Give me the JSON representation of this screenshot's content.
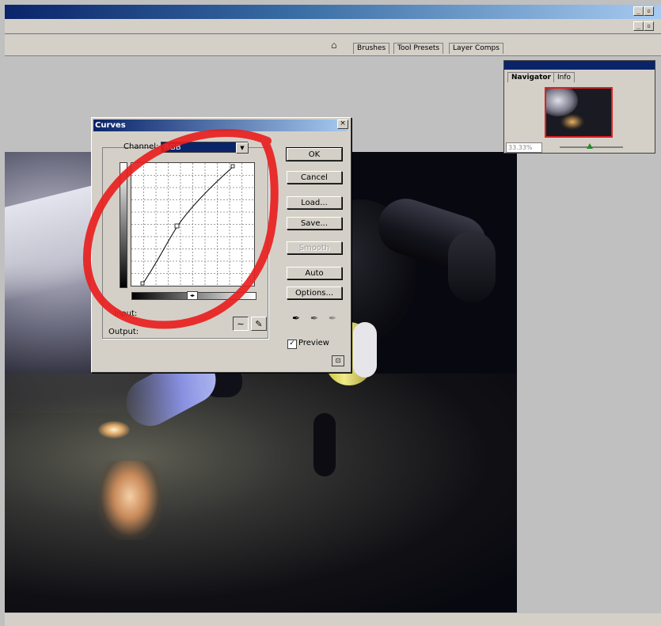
{
  "tabs": [
    {
      "label": "Brushes"
    },
    {
      "label": "Tool Presets"
    },
    {
      "label": "Layer Comps"
    }
  ],
  "navigator": {
    "tabs": [
      {
        "label": "Navigator"
      },
      {
        "label": "Info"
      }
    ],
    "zoom": "33.33%",
    "thumbnail_frame_color": "#e02020"
  },
  "curves": {
    "title": "Curves",
    "channel_label": "Channel:",
    "channel_value": "RGB",
    "input_label": "Input:",
    "output_label": "Output:",
    "buttons": {
      "ok": "OK",
      "cancel": "Cancel",
      "load": "Load...",
      "save": "Save...",
      "smooth": "Smooth",
      "auto": "Auto",
      "options": "Options..."
    },
    "preview_label": "Preview",
    "preview_checked": true
  },
  "annotation": {
    "color": "#e82020"
  },
  "colors": {
    "titlebar": "#0a246a",
    "dialog_bg": "#d4d0c8",
    "workspace": "#c0c0c0"
  },
  "icons": {
    "close": "close-icon",
    "curve_tool": "curve-point-icon",
    "pencil_tool": "pencil-icon",
    "black_eyedropper": "eyedropper-icon",
    "gray_eyedropper": "eyedropper-icon",
    "white_eyedropper": "eyedropper-icon"
  }
}
